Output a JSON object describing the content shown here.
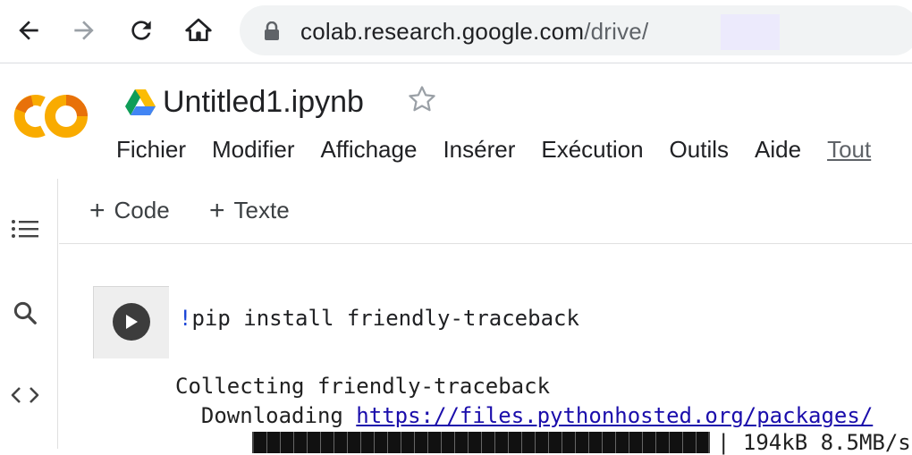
{
  "browser": {
    "url_host": "colab.research.google.com",
    "url_path": "/drive/"
  },
  "header": {
    "doc_title": "Untitled1.ipynb"
  },
  "menu": [
    "Fichier",
    "Modifier",
    "Affichage",
    "Insérer",
    "Exécution",
    "Outils",
    "Aide",
    "Tout"
  ],
  "toolbar": {
    "code_label": "Code",
    "text_label": "Texte"
  },
  "cell": {
    "bang": "!",
    "command": "pip install friendly-traceback",
    "output_line1": "Collecting friendly-traceback",
    "output_line2_prefix": "  Downloading ",
    "output_link": "https://files.pythonhosted.org/packages/",
    "progress_text": "| 194kB 8.5MB/s",
    "progress_percent": 100
  },
  "colors": {
    "colab_orange": "#f9ab00",
    "colab_orange_dark": "#e8710a",
    "link": "#1a0dab",
    "bang": "#1a45d6"
  }
}
